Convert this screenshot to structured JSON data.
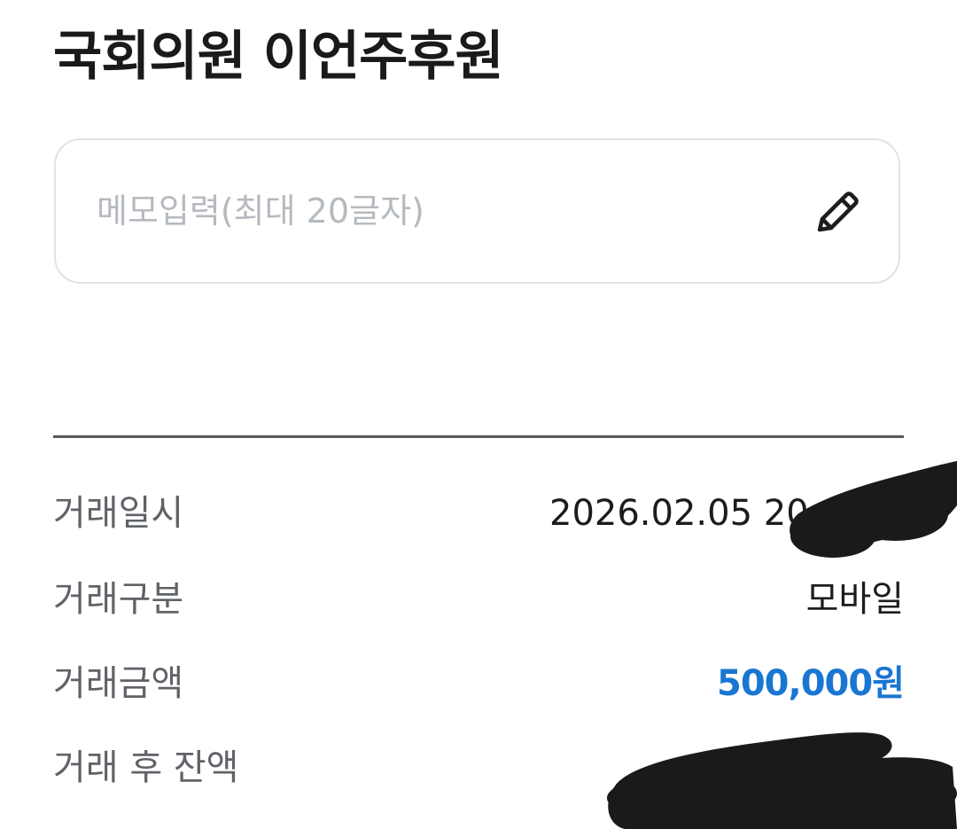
{
  "header": {
    "title": "국회의원 이언주후원"
  },
  "memo": {
    "placeholder": "메모입력(최대 20글자)",
    "value": "",
    "edit_icon": "pencil-icon"
  },
  "details": {
    "rows": [
      {
        "label": "거래일시",
        "value": "2026.02.05  20:"
      },
      {
        "label": "거래구분",
        "value": "모바일"
      },
      {
        "label": "거래금액",
        "value": "500,000원"
      },
      {
        "label": "거래 후 잔액",
        "value": ""
      }
    ]
  },
  "colors": {
    "amount": "#1976d2",
    "divider": "#55585c",
    "label": "#5f6368",
    "placeholder": "#b5bac0",
    "border": "#dfe2e6",
    "redaction": "#1a1a1a"
  }
}
